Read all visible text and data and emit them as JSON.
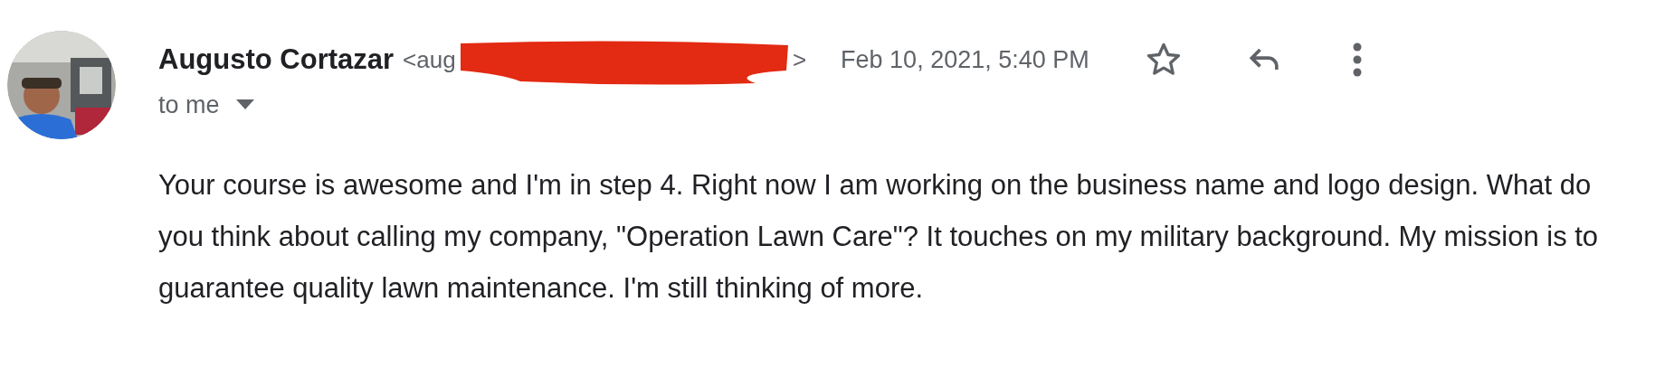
{
  "message": {
    "sender_name": "Augusto Cortazar",
    "sender_email_visible": "<aug",
    "sender_email_end": ">",
    "date": "Feb 10, 2021, 5:40 PM",
    "starred": false,
    "recipient": "to me",
    "body": "Your course is awesome and I'm in step 4. Right now I am working on the business name and logo design. What do you think about calling my company, \"Operation Lawn Care\"? It touches on my military background. My mission is to guarantee quality lawn maintenance. I'm still thinking of more."
  }
}
